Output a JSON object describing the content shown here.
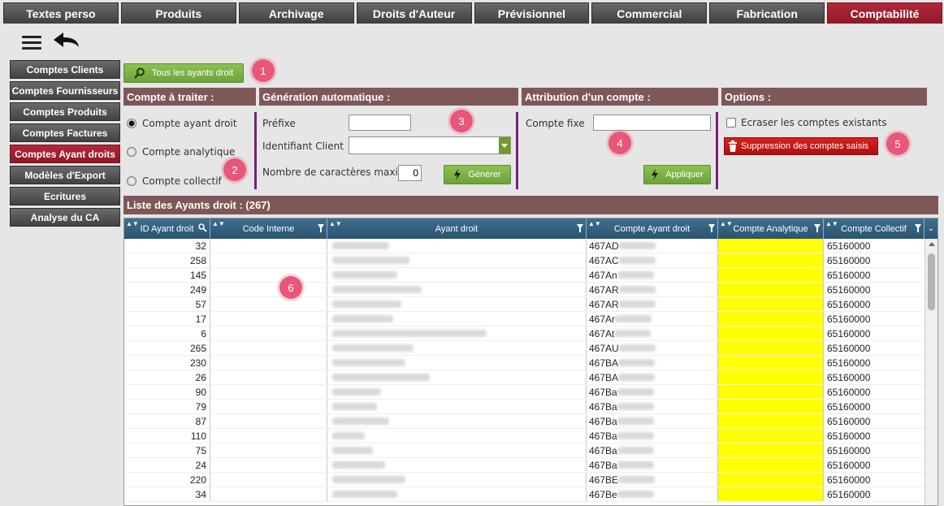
{
  "top_tabs": [
    {
      "label": "Textes perso",
      "active": false
    },
    {
      "label": "Produits",
      "active": false
    },
    {
      "label": "Archivage",
      "active": false
    },
    {
      "label": "Droits d'Auteur",
      "active": false
    },
    {
      "label": "Prévisionnel",
      "active": false
    },
    {
      "label": "Commercial",
      "active": false
    },
    {
      "label": "Fabrication",
      "active": false
    },
    {
      "label": "Comptabilité",
      "active": true
    }
  ],
  "side_menu": [
    {
      "label": "Comptes Clients",
      "active": false
    },
    {
      "label": "Comptes Fournisseurs",
      "active": false
    },
    {
      "label": "Comptes Produits",
      "active": false
    },
    {
      "label": "Comptes Factures",
      "active": false
    },
    {
      "label": "Comptes Ayant droits",
      "active": true
    },
    {
      "label": "Modèles d'Export",
      "active": false
    },
    {
      "label": "Ecritures",
      "active": false
    },
    {
      "label": "Analyse du CA",
      "active": false
    }
  ],
  "toolbar": {
    "all_rights_holders_label": "Tous les ayants droit"
  },
  "sections": {
    "compte_a_traiter": "Compte à traiter :",
    "generation": "Génération automatique :",
    "attribution": "Attribution d'un compte :",
    "options": "Options :"
  },
  "compte_a_traiter": {
    "options": [
      "Compte ayant droit",
      "Compte analytique",
      "Compte collectif"
    ],
    "selected": 0
  },
  "generation": {
    "prefixe_label": "Préfixe",
    "prefixe_value": "",
    "identifiant_label": "Identifiant Client",
    "identifiant_value": "",
    "nb_car_label": "Nombre de caractères maxi",
    "nb_car_value": "0",
    "generer_label": "Générer"
  },
  "attribution": {
    "compte_fixe_label": "Compte fixe",
    "compte_fixe_value": "",
    "appliquer_label": "Appliquer"
  },
  "options": {
    "ecraser_label": "Ecraser les comptes existants",
    "ecraser_checked": false,
    "suppression_label": "Suppression des comptes saisis"
  },
  "badges": [
    "1",
    "2",
    "3",
    "4",
    "5",
    "6"
  ],
  "list": {
    "title": "Liste des Ayants droit : (267)",
    "columns": [
      "ID Ayant droit",
      "Code Interne",
      "Ayant droit",
      "Compte Ayant droit",
      "Compte Analytique",
      "Compte Collectif"
    ],
    "rows": [
      {
        "id": "32",
        "compte": "467AD",
        "collectif": "65160000"
      },
      {
        "id": "258",
        "compte": "467AC",
        "collectif": "65160000"
      },
      {
        "id": "145",
        "compte": "467An",
        "collectif": "65160000"
      },
      {
        "id": "249",
        "compte": "467AR",
        "collectif": "65160000"
      },
      {
        "id": "57",
        "compte": "467AR",
        "collectif": "65160000"
      },
      {
        "id": "17",
        "compte": "467Ar",
        "collectif": "65160000"
      },
      {
        "id": "6",
        "compte": "467At",
        "collectif": "65160000"
      },
      {
        "id": "265",
        "compte": "467AU",
        "collectif": "65160000"
      },
      {
        "id": "230",
        "compte": "467BA",
        "collectif": "65160000"
      },
      {
        "id": "26",
        "compte": "467BA",
        "collectif": "65160000"
      },
      {
        "id": "90",
        "compte": "467Ba",
        "collectif": "65160000"
      },
      {
        "id": "79",
        "compte": "467Ba",
        "collectif": "65160000"
      },
      {
        "id": "87",
        "compte": "467Ba",
        "collectif": "65160000"
      },
      {
        "id": "110",
        "compte": "467Ba",
        "collectif": "65160000"
      },
      {
        "id": "75",
        "compte": "467Ba",
        "collectif": "65160000"
      },
      {
        "id": "24",
        "compte": "467Ba",
        "collectif": "65160000"
      },
      {
        "id": "220",
        "compte": "467BE",
        "collectif": "65160000"
      },
      {
        "id": "34",
        "compte": "467Be",
        "collectif": "65160000"
      }
    ]
  },
  "colors": {
    "accent_red": "#a01f30",
    "section_brown": "#7e5858",
    "analytic_yellow": "#ffff00",
    "badge_pink": "#e8577a"
  }
}
